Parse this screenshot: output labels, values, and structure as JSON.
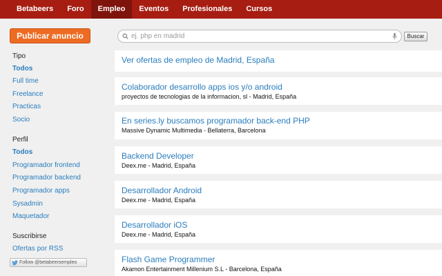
{
  "nav": {
    "brand": "Betabeers",
    "items": [
      "Foro",
      "Empleo",
      "Eventos",
      "Profesionales",
      "Cursos"
    ],
    "active": "Empleo"
  },
  "sidebar": {
    "publish_label": "Publicar anuncio",
    "tipo_heading": "Tipo",
    "tipo_items": [
      "Todos",
      "Full time",
      "Freelance",
      "Practicas",
      "Socio"
    ],
    "perfil_heading": "Perfil",
    "perfil_items": [
      "Todos",
      "Programador frontend",
      "Programador backend",
      "Programador apps",
      "Sysadmin",
      "Maquetador"
    ],
    "suscribirse_heading": "Suscribirse",
    "rss_label": "Ofertas por RSS",
    "follow_label": "Follow @betabeersempleo"
  },
  "search": {
    "placeholder": "ej. php en madrid",
    "button_label": "Buscar"
  },
  "listings": {
    "header": "Ver ofertas de empleo de Madrid, España",
    "jobs": [
      {
        "title": "Colaborador desarrollo apps ios y/o android",
        "subtitle": "proyectos de tecnologias de la informacion, sl - Madrid, España"
      },
      {
        "title": "En series.ly buscamos programador back-end PHP",
        "subtitle": "Massive Dynamic Multimedia - Bellaterra, Barcelona"
      },
      {
        "title": "Backend Developer",
        "subtitle": "Deex.me - Madrid, España"
      },
      {
        "title": "Desarrollador Android",
        "subtitle": "Deex.me - Madrid, España"
      },
      {
        "title": "Desarrollador iOS",
        "subtitle": "Deex.me - Madrid, España"
      },
      {
        "title": "Flash Game Programmer",
        "subtitle": "Akamon Entertainment Millenium S.L - Barcelona, España"
      }
    ]
  },
  "colors": {
    "nav_bg": "#a71d12",
    "nav_active": "#7e140c",
    "accent_orange": "#ee6b23",
    "link_blue": "#2a7dbd",
    "page_bg": "#f0f0f0"
  }
}
